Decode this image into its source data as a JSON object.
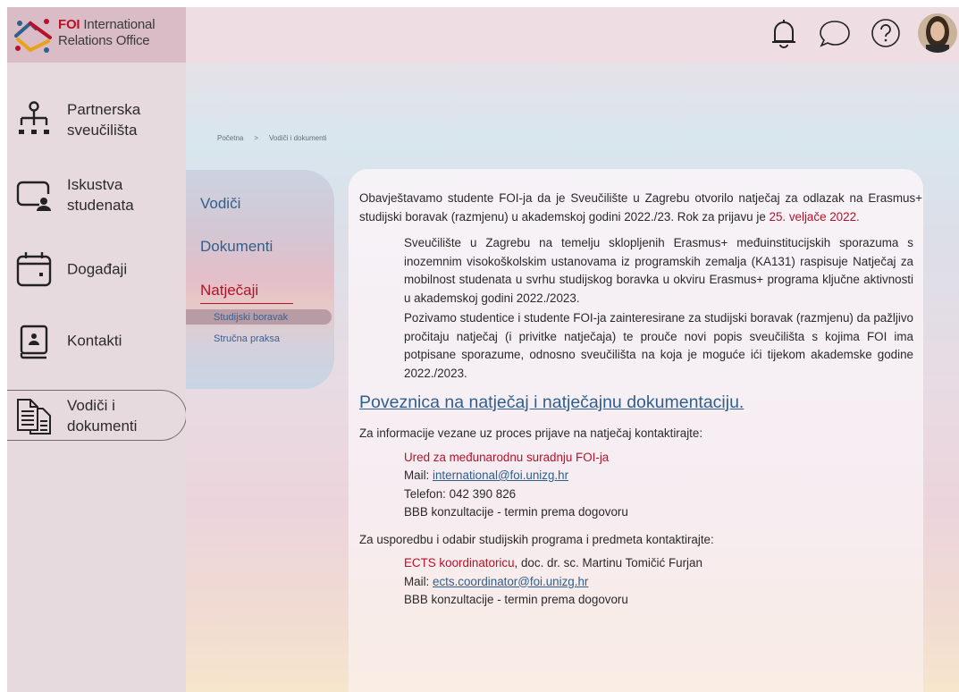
{
  "brand": {
    "name_red": "FOI",
    "name_rest": " International",
    "name_line2": "Relations Office",
    "colors": {
      "accent": "#b5122a",
      "link": "#2f5f8c",
      "sidebar": "#e7dadf",
      "logo_box": "#d9bcc5"
    }
  },
  "header_icons": [
    "bell-icon",
    "chat-icon",
    "help-icon",
    "avatar"
  ],
  "sidebar": {
    "items": [
      {
        "label": "Partnerska\nsveučilišta",
        "icon": "network-icon"
      },
      {
        "label": "Iskustva\nstudenata",
        "icon": "user-screen-icon"
      },
      {
        "label": "Događaji",
        "icon": "calendar-icon"
      },
      {
        "label": "Kontakti",
        "icon": "contact-book-icon"
      },
      {
        "label": "Vodiči i\ndokumenti",
        "icon": "documents-icon",
        "active": true
      }
    ]
  },
  "breadcrumb": {
    "home": "Početna",
    "separator": ">",
    "current": "Vodiči i dokumenti"
  },
  "subnav": {
    "items": [
      "Vodiči",
      "Dokumenti",
      "Natječaji"
    ],
    "active": "Natječaji",
    "subitems": [
      "Studijski boravak",
      "Stručna praksa"
    ],
    "active_sub": "Studijski boravak"
  },
  "content": {
    "intro": "Obavještavamo studente FOI-ja da je Sveučilište u Zagrebu otvorilo natječaj za odlazak na Erasmus+ studijski boravak (razmjenu) u akademskoj godini 2022./23. Rok za prijavu je ",
    "deadline": "25. veljače 2022.",
    "para1": "Sveučilište u Zagrebu na temelju sklopljenih Erasmus+ međuinstitucijskih sporazuma s inozemnim visokoškolskim ustanovama iz programskih zemalja (KA131) raspisuje Natječaj za mobilnost studenata u svrhu studijskog boravka u okviru Erasmus+ programa ključne aktivnosti u akademskoj godini 2022./2023.",
    "para2": "Pozivamo studentice i studente FOI-ja zainteresirane za studijski boravak (razmjenu) da pažljivo pročitaju natječaj (i privitke natječaja) te prouče novi popis sveučilišta s kojima FOI ima potpisane sporazume, odnosno sveučilišta na koja je moguće ići tijekom akademske godine 2022./2023.",
    "link": "Poveznica na natječaj i natječajnu dokumentaciju.",
    "contact1_intro": "Za informacije vezane uz proces prijave na natječaj kontaktirajte:",
    "contact1_office": "Ured za međunarodnu suradnju FOI-ja",
    "contact1_mail_label": "Mail: ",
    "contact1_mail": "international@foi.unizg.hr",
    "contact1_phone": "Telefon: 042 390 826",
    "contact1_bbb": "BBB konzultacije - termin prema dogovoru",
    "contact2_intro": "Za usporedbu i odabir studijskih programa i predmeta kontaktirajte:",
    "contact2_role": "ECTS koordinatoricu",
    "contact2_person": ", doc. dr. sc. Martinu Tomičić Furjan",
    "contact2_mail_label": "Mail: ",
    "contact2_mail": "ects.coordinator@foi.unizg.hr",
    "contact2_bbb": "BBB konzultacije - termin prema dogovoru"
  }
}
